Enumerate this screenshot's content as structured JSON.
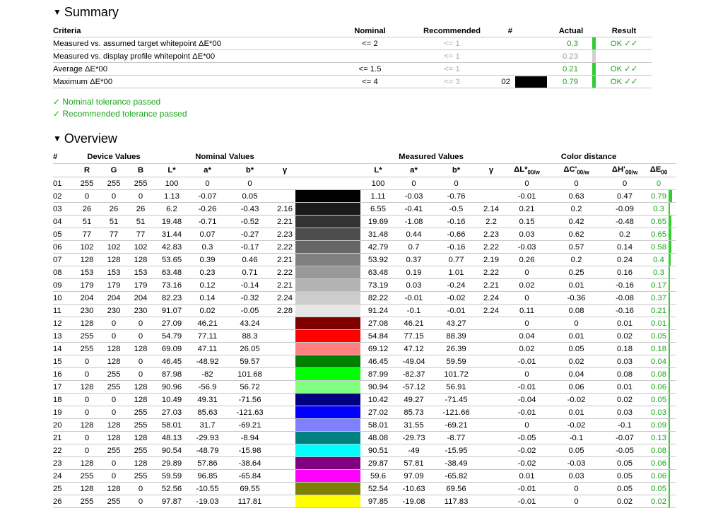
{
  "summary": {
    "title": "Summary",
    "headers": {
      "criteria": "Criteria",
      "nominal": "Nominal",
      "recommended": "Recommended",
      "hash": "#",
      "actual": "Actual",
      "result": "Result"
    },
    "rows": [
      {
        "criteria": "Measured vs. assumed target whitepoint ΔE*00",
        "nominal": "<= 2",
        "recommended": "<= 1",
        "id": "",
        "swatch": "",
        "actual": "0.3",
        "actual_color": "#1aa51a",
        "bar_color": "#33cc33",
        "result": "OK ✓✓"
      },
      {
        "criteria": "Measured vs. display profile whitepoint ΔE*00",
        "nominal": "",
        "recommended": "<= 1",
        "id": "",
        "swatch": "",
        "actual": "0.23",
        "actual_color": "#999999",
        "bar_color": "#d0d0d0",
        "result": ""
      },
      {
        "criteria": "Average ΔE*00",
        "nominal": "<= 1.5",
        "recommended": "<= 1",
        "id": "",
        "swatch": "",
        "actual": "0.21",
        "actual_color": "#1aa51a",
        "bar_color": "#33cc33",
        "result": "OK ✓✓"
      },
      {
        "criteria": "Maximum ΔE*00",
        "nominal": "<= 4",
        "recommended": "<= 3",
        "id": "02",
        "swatch": "#000000",
        "actual": "0.79",
        "actual_color": "#1aa51a",
        "bar_color": "#33cc33",
        "result": "OK ✓✓"
      }
    ],
    "messages": [
      "✓ Nominal tolerance passed",
      "✓ Recommended tolerance passed"
    ]
  },
  "overview": {
    "title": "Overview",
    "group_headers": {
      "hash": "#",
      "device": "Device Values",
      "nominal": "Nominal Values",
      "measured": "Measured Values",
      "distance": "Color distance"
    },
    "col_headers": {
      "R": "R",
      "G": "G",
      "B": "B",
      "L": "L*",
      "a": "a*",
      "b": "b*",
      "gamma": "γ",
      "mL": "L*",
      "ma": "a*",
      "mb": "b*",
      "mgamma": "γ",
      "dL": "ΔL*",
      "dC": "ΔC'",
      "dH": "ΔH'",
      "dE": "ΔE",
      "sub_w": "00/w",
      "sub_00": "00"
    },
    "rows": [
      {
        "id": "01",
        "r": "255",
        "g": "255",
        "b": "255",
        "nL": "100",
        "na": "0",
        "nb": "0",
        "ng": "",
        "nsw": "#ffffff",
        "msw": "#ffffff",
        "mL": "100",
        "ma": "0",
        "mb": "0",
        "mg": "",
        "dL": "0",
        "dC": "0",
        "dH": "0",
        "dE": "0",
        "de_val": 0
      },
      {
        "id": "02",
        "r": "0",
        "g": "0",
        "b": "0",
        "nL": "1.13",
        "na": "-0.07",
        "nb": "0.05",
        "ng": "",
        "nsw": "#000000",
        "msw": "#000000",
        "mL": "1.11",
        "ma": "-0.03",
        "mb": "-0.76",
        "mg": "",
        "dL": "-0.01",
        "dC": "0.63",
        "dH": "0.47",
        "dE": "0.79",
        "de_val": 0.79
      },
      {
        "id": "03",
        "r": "26",
        "g": "26",
        "b": "26",
        "nL": "6.2",
        "na": "-0.26",
        "nb": "-0.43",
        "ng": "2.16",
        "nsw": "#1a1a1a",
        "msw": "#1a1a1a",
        "mL": "6.55",
        "ma": "-0.41",
        "mb": "-0.5",
        "mg": "2.14",
        "dL": "0.21",
        "dC": "0.2",
        "dH": "-0.09",
        "dE": "0.3",
        "de_val": 0.3
      },
      {
        "id": "04",
        "r": "51",
        "g": "51",
        "b": "51",
        "nL": "19.48",
        "na": "-0.71",
        "nb": "-0.52",
        "ng": "2.21",
        "nsw": "#333333",
        "msw": "#333333",
        "mL": "19.69",
        "ma": "-1.08",
        "mb": "-0.16",
        "mg": "2.2",
        "dL": "0.15",
        "dC": "0.42",
        "dH": "-0.48",
        "dE": "0.65",
        "de_val": 0.65
      },
      {
        "id": "05",
        "r": "77",
        "g": "77",
        "b": "77",
        "nL": "31.44",
        "na": "0.07",
        "nb": "-0.27",
        "ng": "2.23",
        "nsw": "#4d4d4d",
        "msw": "#4d4d4d",
        "mL": "31.48",
        "ma": "0.44",
        "mb": "-0.66",
        "mg": "2.23",
        "dL": "0.03",
        "dC": "0.62",
        "dH": "0.2",
        "dE": "0.65",
        "de_val": 0.65
      },
      {
        "id": "06",
        "r": "102",
        "g": "102",
        "b": "102",
        "nL": "42.83",
        "na": "0.3",
        "nb": "-0.17",
        "ng": "2.22",
        "nsw": "#666666",
        "msw": "#666666",
        "mL": "42.79",
        "ma": "0.7",
        "mb": "-0.16",
        "mg": "2.22",
        "dL": "-0.03",
        "dC": "0.57",
        "dH": "0.14",
        "dE": "0.58",
        "de_val": 0.58
      },
      {
        "id": "07",
        "r": "128",
        "g": "128",
        "b": "128",
        "nL": "53.65",
        "na": "0.39",
        "nb": "0.46",
        "ng": "2.21",
        "nsw": "#808080",
        "msw": "#808080",
        "mL": "53.92",
        "ma": "0.37",
        "mb": "0.77",
        "mg": "2.19",
        "dL": "0.26",
        "dC": "0.2",
        "dH": "0.24",
        "dE": "0.4",
        "de_val": 0.4
      },
      {
        "id": "08",
        "r": "153",
        "g": "153",
        "b": "153",
        "nL": "63.48",
        "na": "0.23",
        "nb": "0.71",
        "ng": "2.22",
        "nsw": "#999999",
        "msw": "#999999",
        "mL": "63.48",
        "ma": "0.19",
        "mb": "1.01",
        "mg": "2.22",
        "dL": "0",
        "dC": "0.25",
        "dH": "0.16",
        "dE": "0.3",
        "de_val": 0.3
      },
      {
        "id": "09",
        "r": "179",
        "g": "179",
        "b": "179",
        "nL": "73.16",
        "na": "0.12",
        "nb": "-0.14",
        "ng": "2.21",
        "nsw": "#b3b3b3",
        "msw": "#b3b3b3",
        "mL": "73.19",
        "ma": "0.03",
        "mb": "-0.24",
        "mg": "2.21",
        "dL": "0.02",
        "dC": "0.01",
        "dH": "-0.16",
        "dE": "0.17",
        "de_val": 0.17
      },
      {
        "id": "10",
        "r": "204",
        "g": "204",
        "b": "204",
        "nL": "82.23",
        "na": "0.14",
        "nb": "-0.32",
        "ng": "2.24",
        "nsw": "#cccccc",
        "msw": "#cccccc",
        "mL": "82.22",
        "ma": "-0.01",
        "mb": "-0.02",
        "mg": "2.24",
        "dL": "0",
        "dC": "-0.36",
        "dH": "-0.08",
        "dE": "0.37",
        "de_val": 0.37
      },
      {
        "id": "11",
        "r": "230",
        "g": "230",
        "b": "230",
        "nL": "91.07",
        "na": "0.02",
        "nb": "-0.05",
        "ng": "2.28",
        "nsw": "#e6e6e6",
        "msw": "#e6e6e6",
        "mL": "91.24",
        "ma": "-0.1",
        "mb": "-0.01",
        "mg": "2.24",
        "dL": "0.11",
        "dC": "0.08",
        "dH": "-0.16",
        "dE": "0.21",
        "de_val": 0.21
      },
      {
        "id": "12",
        "r": "128",
        "g": "0",
        "b": "0",
        "nL": "27.09",
        "na": "46.21",
        "nb": "43.24",
        "ng": "",
        "nsw": "#800000",
        "msw": "#800000",
        "mL": "27.08",
        "ma": "46.21",
        "mb": "43.27",
        "mg": "",
        "dL": "0",
        "dC": "0",
        "dH": "0.01",
        "dE": "0.01",
        "de_val": 0.01
      },
      {
        "id": "13",
        "r": "255",
        "g": "0",
        "b": "0",
        "nL": "54.79",
        "na": "77.11",
        "nb": "88.3",
        "ng": "",
        "nsw": "#ff0000",
        "msw": "#ff0000",
        "mL": "54.84",
        "ma": "77.15",
        "mb": "88.39",
        "mg": "",
        "dL": "0.04",
        "dC": "0.01",
        "dH": "0.02",
        "dE": "0.05",
        "de_val": 0.05
      },
      {
        "id": "14",
        "r": "255",
        "g": "128",
        "b": "128",
        "nL": "69.09",
        "na": "47.11",
        "nb": "26.05",
        "ng": "",
        "nsw": "#ff8080",
        "msw": "#ff8080",
        "mL": "69.12",
        "ma": "47.12",
        "mb": "26.39",
        "mg": "",
        "dL": "0.02",
        "dC": "0.05",
        "dH": "0.18",
        "dE": "0.18",
        "de_val": 0.18
      },
      {
        "id": "15",
        "r": "0",
        "g": "128",
        "b": "0",
        "nL": "46.45",
        "na": "-48.92",
        "nb": "59.57",
        "ng": "",
        "nsw": "#008000",
        "msw": "#008000",
        "mL": "46.45",
        "ma": "-49.04",
        "mb": "59.59",
        "mg": "",
        "dL": "-0.01",
        "dC": "0.02",
        "dH": "0.03",
        "dE": "0.04",
        "de_val": 0.04
      },
      {
        "id": "16",
        "r": "0",
        "g": "255",
        "b": "0",
        "nL": "87.98",
        "na": "-82",
        "nb": "101.68",
        "ng": "",
        "nsw": "#00ff00",
        "msw": "#00ff00",
        "mL": "87.99",
        "ma": "-82.37",
        "mb": "101.72",
        "mg": "",
        "dL": "0",
        "dC": "0.04",
        "dH": "0.08",
        "dE": "0.08",
        "de_val": 0.08
      },
      {
        "id": "17",
        "r": "128",
        "g": "255",
        "b": "128",
        "nL": "90.96",
        "na": "-56.9",
        "nb": "56.72",
        "ng": "",
        "nsw": "#80ff80",
        "msw": "#80ff80",
        "mL": "90.94",
        "ma": "-57.12",
        "mb": "56.91",
        "mg": "",
        "dL": "-0.01",
        "dC": "0.06",
        "dH": "0.01",
        "dE": "0.06",
        "de_val": 0.06
      },
      {
        "id": "18",
        "r": "0",
        "g": "0",
        "b": "128",
        "nL": "10.49",
        "na": "49.31",
        "nb": "-71.56",
        "ng": "",
        "nsw": "#000080",
        "msw": "#000080",
        "mL": "10.42",
        "ma": "49.27",
        "mb": "-71.45",
        "mg": "",
        "dL": "-0.04",
        "dC": "-0.02",
        "dH": "0.02",
        "dE": "0.05",
        "de_val": 0.05
      },
      {
        "id": "19",
        "r": "0",
        "g": "0",
        "b": "255",
        "nL": "27.03",
        "na": "85.63",
        "nb": "-121.63",
        "ng": "",
        "nsw": "#0000ff",
        "msw": "#0000ff",
        "mL": "27.02",
        "ma": "85.73",
        "mb": "-121.66",
        "mg": "",
        "dL": "-0.01",
        "dC": "0.01",
        "dH": "0.03",
        "dE": "0.03",
        "de_val": 0.03
      },
      {
        "id": "20",
        "r": "128",
        "g": "128",
        "b": "255",
        "nL": "58.01",
        "na": "31.7",
        "nb": "-69.21",
        "ng": "",
        "nsw": "#8080ff",
        "msw": "#8080ff",
        "mL": "58.01",
        "ma": "31.55",
        "mb": "-69.21",
        "mg": "",
        "dL": "0",
        "dC": "-0.02",
        "dH": "-0.1",
        "dE": "0.09",
        "de_val": 0.09
      },
      {
        "id": "21",
        "r": "0",
        "g": "128",
        "b": "128",
        "nL": "48.13",
        "na": "-29.93",
        "nb": "-8.94",
        "ng": "",
        "nsw": "#008080",
        "msw": "#008080",
        "mL": "48.08",
        "ma": "-29.73",
        "mb": "-8.77",
        "mg": "",
        "dL": "-0.05",
        "dC": "-0.1",
        "dH": "-0.07",
        "dE": "0.13",
        "de_val": 0.13
      },
      {
        "id": "22",
        "r": "0",
        "g": "255",
        "b": "255",
        "nL": "90.54",
        "na": "-48.79",
        "nb": "-15.98",
        "ng": "",
        "nsw": "#00ffff",
        "msw": "#00ffff",
        "mL": "90.51",
        "ma": "-49",
        "mb": "-15.95",
        "mg": "",
        "dL": "-0.02",
        "dC": "0.05",
        "dH": "-0.05",
        "dE": "0.08",
        "de_val": 0.08
      },
      {
        "id": "23",
        "r": "128",
        "g": "0",
        "b": "128",
        "nL": "29.89",
        "na": "57.86",
        "nb": "-38.64",
        "ng": "",
        "nsw": "#800080",
        "msw": "#800080",
        "mL": "29.87",
        "ma": "57.81",
        "mb": "-38.49",
        "mg": "",
        "dL": "-0.02",
        "dC": "-0.03",
        "dH": "0.05",
        "dE": "0.06",
        "de_val": 0.06
      },
      {
        "id": "24",
        "r": "255",
        "g": "0",
        "b": "255",
        "nL": "59.59",
        "na": "96.85",
        "nb": "-65.84",
        "ng": "",
        "nsw": "#ff00ff",
        "msw": "#ff00ff",
        "mL": "59.6",
        "ma": "97.09",
        "mb": "-65.82",
        "mg": "",
        "dL": "0.01",
        "dC": "0.03",
        "dH": "0.05",
        "dE": "0.06",
        "de_val": 0.06
      },
      {
        "id": "25",
        "r": "128",
        "g": "128",
        "b": "0",
        "nL": "52.56",
        "na": "-10.55",
        "nb": "69.55",
        "ng": "",
        "nsw": "#808000",
        "msw": "#808000",
        "mL": "52.54",
        "ma": "-10.63",
        "mb": "69.56",
        "mg": "",
        "dL": "-0.01",
        "dC": "0",
        "dH": "0.05",
        "dE": "0.05",
        "de_val": 0.05
      },
      {
        "id": "26",
        "r": "255",
        "g": "255",
        "b": "0",
        "nL": "97.87",
        "na": "-19.03",
        "nb": "117.81",
        "ng": "",
        "nsw": "#ffff00",
        "msw": "#ffff00",
        "mL": "97.85",
        "ma": "-19.08",
        "mb": "117.83",
        "mg": "",
        "dL": "-0.01",
        "dC": "0",
        "dH": "0.02",
        "dE": "0.02",
        "de_val": 0.02
      }
    ]
  },
  "colors": {
    "pass_green": "#1aa51a",
    "bar_green": "#33cc33",
    "grid": "#c8c8c8"
  }
}
